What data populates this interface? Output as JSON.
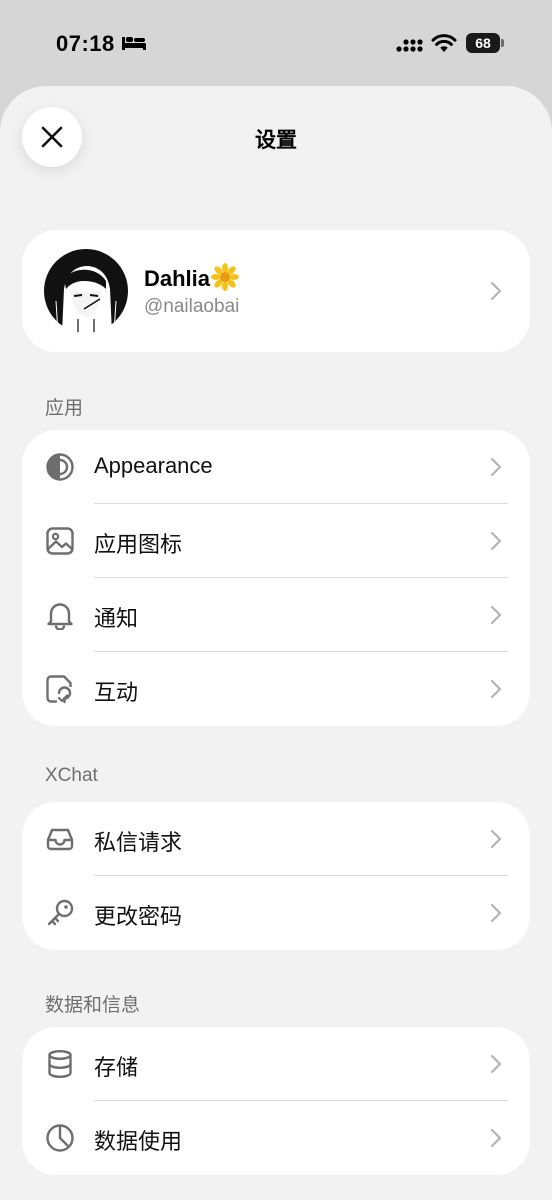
{
  "status_bar": {
    "time": "07:18",
    "battery": "68"
  },
  "header": {
    "title": "设置"
  },
  "profile": {
    "name": "Dahlia",
    "handle": "@nailaobai"
  },
  "sections": [
    {
      "label": "应用",
      "items": [
        {
          "label": "Appearance",
          "icon": "appearance-icon"
        },
        {
          "label": "应用图标",
          "icon": "image-icon"
        },
        {
          "label": "通知",
          "icon": "bell-icon"
        },
        {
          "label": "互动",
          "icon": "interaction-icon"
        }
      ]
    },
    {
      "label": "XChat",
      "items": [
        {
          "label": "私信请求",
          "icon": "inbox-icon"
        },
        {
          "label": "更改密码",
          "icon": "key-icon"
        }
      ]
    },
    {
      "label": "数据和信息",
      "items": [
        {
          "label": "存储",
          "icon": "database-icon"
        },
        {
          "label": "数据使用",
          "icon": "clock-icon"
        }
      ]
    }
  ],
  "colors": {
    "background": "#f2f2f2",
    "card": "#ffffff",
    "icon": "#6e6e6e",
    "chevron": "#b4b4b4",
    "section_label": "#6f6f6f"
  }
}
